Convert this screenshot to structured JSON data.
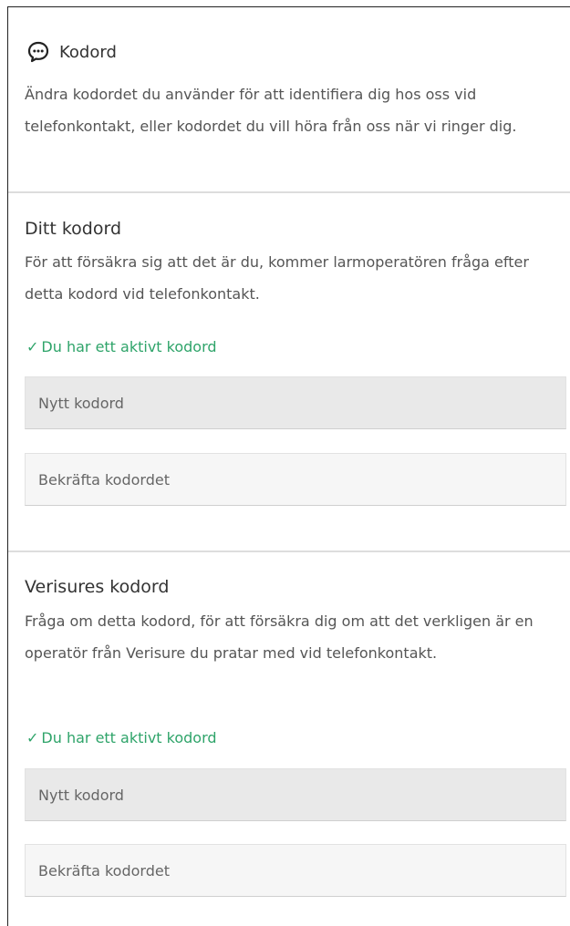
{
  "header": {
    "icon": "chat-bubble-icon",
    "title": "Kodord",
    "intro": "Ändra kodordet du använder för att identifiera dig hos oss vid telefonkontakt, eller kodordet du vill höra från oss när vi ringer dig."
  },
  "sections": [
    {
      "title": "Ditt kodord",
      "description": "För att försäkra sig att det är du, kommer larmoperatören fråga efter detta kodord vid telefonkontakt.",
      "status": "Du har ett aktivt kodord",
      "new_placeholder": "Nytt kodord",
      "confirm_placeholder": "Bekräfta kodordet"
    },
    {
      "title": "Verisures kodord",
      "description": "Fråga om detta kodord, för att försäkra dig om att det verkligen är en operatör från Verisure du pratar med vid telefonkontakt.",
      "status": "Du har ett aktivt kodord",
      "new_placeholder": "Nytt kodord",
      "confirm_placeholder": "Bekräfta kodordet"
    }
  ],
  "colors": {
    "success": "#2fa46a",
    "field_gray": "#e9e9e9",
    "field_light": "#f6f6f6"
  }
}
